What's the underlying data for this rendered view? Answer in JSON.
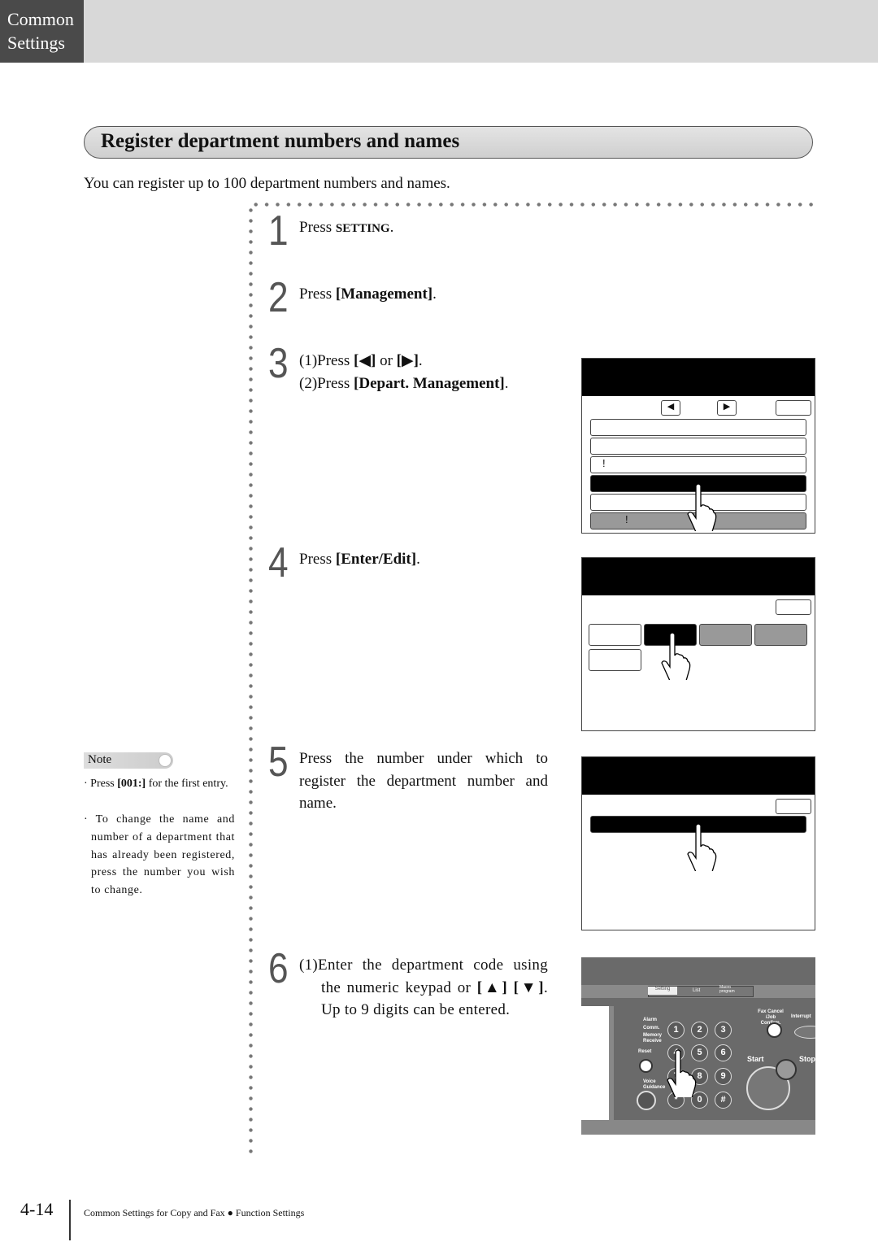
{
  "header": {
    "section_line1": "Common",
    "section_line2": "Settings"
  },
  "title": "Register department numbers and names",
  "intro": "You can register up to 100 department numbers and names.",
  "steps": [
    {
      "num": "1",
      "parts": [
        "Press ",
        "SETTING",
        "."
      ]
    },
    {
      "num": "2",
      "parts": [
        "Press ",
        "[Management]",
        "."
      ]
    },
    {
      "num": "3",
      "line1": [
        "(1)Press ",
        "[◀]",
        " or ",
        "[▶]",
        "."
      ],
      "line2": [
        "(2)Press ",
        "[Depart. Management]",
        "."
      ]
    },
    {
      "num": "4",
      "parts": [
        "Press ",
        "[Enter/Edit]",
        "."
      ]
    },
    {
      "num": "5",
      "text": "Press the number under which to register the department number and name."
    },
    {
      "num": "6",
      "parts": [
        "(1)Enter the department code using the numeric keypad or ",
        "[▲] [▼]",
        ". Up to 9 digits can be entered."
      ]
    }
  ],
  "screen1": {
    "row_marks": [
      "!",
      "!"
    ]
  },
  "keypad": {
    "keys": [
      "1",
      "2",
      "3",
      "4",
      "5",
      "6",
      "7",
      "8",
      "9",
      "*",
      "0",
      "#"
    ],
    "tabs": [
      "Setting",
      "List",
      "Macro program"
    ],
    "labels": {
      "alarm": "Alarm",
      "comm": "Comm.",
      "memory": "Memory Receive",
      "reset": "Reset",
      "voice": "Voice Guidance",
      "fax_cancel": "Fax Cancel /Job Confirm.",
      "interrupt": "Interrupt",
      "start": "Start",
      "stop": "Stop"
    }
  },
  "note": {
    "label": "Note",
    "items": [
      [
        "· Press ",
        "[001:]",
        " for the first entry."
      ],
      [
        "· To change the name and number of a department that has already been registered, press the number you wish to change."
      ]
    ]
  },
  "footer": {
    "page": "4-14",
    "text": "Common Settings for Copy and Fax ● Function Settings"
  }
}
